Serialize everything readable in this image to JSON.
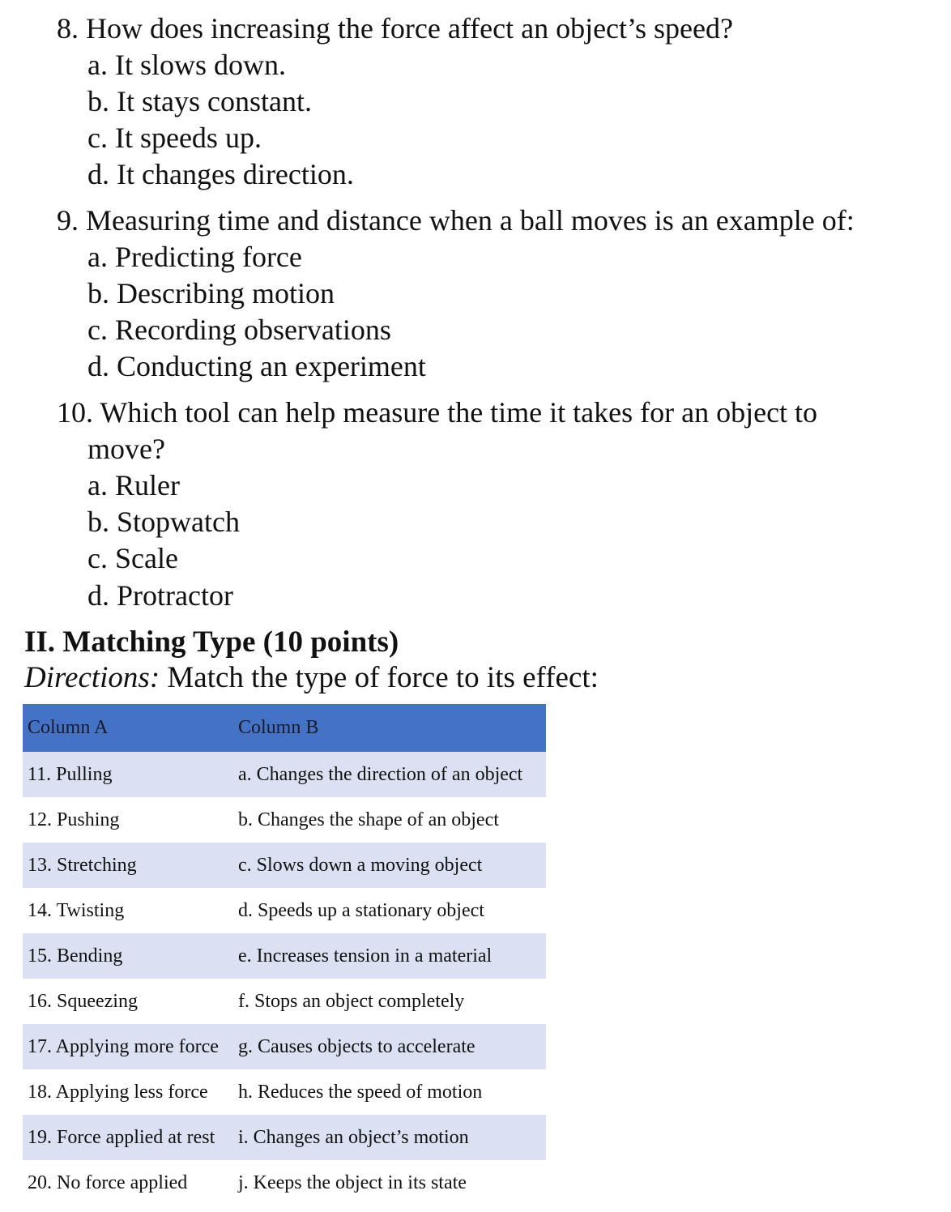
{
  "questions": [
    {
      "number": "8.",
      "text": "How does increasing the force affect an object’s speed?",
      "options": [
        "a. It slows down.",
        "b. It stays constant.",
        "c. It speeds up.",
        "d. It changes direction."
      ]
    },
    {
      "number": "9.",
      "text": "Measuring time and distance when a ball moves is an example of:",
      "options": [
        "a. Predicting force",
        "b. Describing motion",
        "c. Recording observations",
        "d. Conducting an experiment"
      ]
    },
    {
      "number": "10.",
      "text": "Which tool can help measure the time it takes for an object to",
      "text_cont": "move?",
      "options": [
        "a. Ruler",
        "b. Stopwatch",
        "c. Scale",
        "d. Protractor"
      ]
    }
  ],
  "section": {
    "heading": "II. Matching Type (10 points)",
    "directions_label": "Directions:",
    "directions_text": " Match the type of force to its effect:"
  },
  "table": {
    "headers": [
      "Column A",
      "Column B"
    ],
    "header_color": "#4472c4",
    "stripe_color": "#d9e1f2",
    "rows": [
      [
        "11. Pulling",
        "a. Changes the direction of an object"
      ],
      [
        "12. Pushing",
        "b. Changes the shape of an object"
      ],
      [
        "13. Stretching",
        "c. Slows down a moving object"
      ],
      [
        "14. Twisting",
        "d. Speeds up a stationary object"
      ],
      [
        "15. Bending",
        "e. Increases tension in a material"
      ],
      [
        "16. Squeezing",
        "f. Stops an object completely"
      ],
      [
        "17. Applying more force",
        "g. Causes objects to accelerate"
      ],
      [
        "18. Applying less force",
        "h. Reduces the speed of motion"
      ],
      [
        "19. Force applied at rest",
        "i. Changes an object’s motion"
      ],
      [
        "20. No force applied",
        "j. Keeps the object in its state"
      ]
    ]
  }
}
